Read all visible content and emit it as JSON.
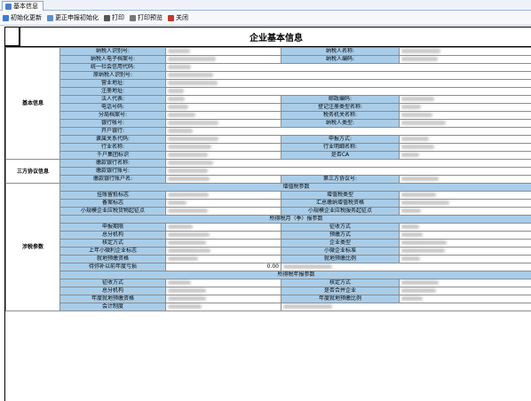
{
  "tab": {
    "label": "基本信息"
  },
  "toolbar": [
    {
      "label": "初始化更新",
      "icon": "refresh-icon",
      "color": "#3a7bd5"
    },
    {
      "label": "更正申报初始化",
      "icon": "edit-icon",
      "color": "#5a8fd0"
    },
    {
      "label": "打印",
      "icon": "printer-icon",
      "color": "#555555"
    },
    {
      "label": "打印预览",
      "icon": "print-preview-icon",
      "color": "#777777"
    },
    {
      "label": "关闭",
      "icon": "close-book-icon",
      "color": "#c0392b"
    }
  ],
  "title": "企业基本信息",
  "sections": {
    "basic": "基本信息",
    "tripartite": "三方协议信息",
    "tax": "涉税参数"
  },
  "basic_rows": [
    {
      "l1": "纳税人识别号:",
      "l2": "纳税人名称:"
    },
    {
      "l1": "纳税人电子档案号:",
      "l2": "纳税人编码:"
    },
    {
      "l1": "统一社会信用代码:"
    },
    {
      "l1": "原纳税人识别号:"
    },
    {
      "l1": "营业地址:"
    },
    {
      "l1": "注册地址:"
    },
    {
      "l1": "法人代表:",
      "l2": "邮政编码:"
    },
    {
      "l1": "电话号码:",
      "l2": "登记注册类型名称:"
    },
    {
      "l1": "分局档案号:",
      "l2": "税务机关名称:"
    },
    {
      "l1": "银行帐号:",
      "l2": "纳税人类型:"
    },
    {
      "l1": "开户银行:"
    },
    {
      "l1": "隶属关系代码:",
      "l2": "申报方式:"
    },
    {
      "l1": "行业名称:",
      "l2": "行业明细名称:"
    },
    {
      "l1": "千户集团标识",
      "l2": "是否CA"
    }
  ],
  "tri_rows": [
    {
      "l1": "缴款银行名称:"
    },
    {
      "l1": "缴款银行账号:"
    },
    {
      "l1": "缴款银行账户名:",
      "l2": "第三方协议号:"
    }
  ],
  "vat_title": "增值税参数",
  "vat_rows": [
    {
      "l1": "挂账留抵标志",
      "l2": "增值税类型"
    },
    {
      "l1": "备案标志",
      "l2": "汇总缴纳增值税资格"
    },
    {
      "l1": "小规模企业应税货物起征点",
      "l2": "小规模企业应税服务起征点"
    }
  ],
  "income_title": "所得税月（季）报参数",
  "income_rows": [
    {
      "l1": "申报期限",
      "l2": "征收方式"
    },
    {
      "l1": "总分机构",
      "l2": "预缴方式"
    },
    {
      "l1": "核定方式",
      "l2": "企业类型"
    },
    {
      "l1": "上年小微利企业标志",
      "l2": "小微企业标准"
    },
    {
      "l1": "就地预缴资格",
      "l2": "就地预缴比例"
    },
    {
      "l1": "待弥补以前年度亏损",
      "v1": "0.00",
      "l2": ""
    }
  ],
  "annual_title": "所得税年报参数",
  "annual_rows": [
    {
      "l1": "征收方式",
      "l2": "核定方式"
    },
    {
      "l1": "总分机构",
      "l2": "是否合并企业"
    },
    {
      "l1": "年度就地预缴资格",
      "l2": "年度就地预缴比例"
    },
    {
      "l1": "会计制度",
      "l2": ""
    }
  ]
}
